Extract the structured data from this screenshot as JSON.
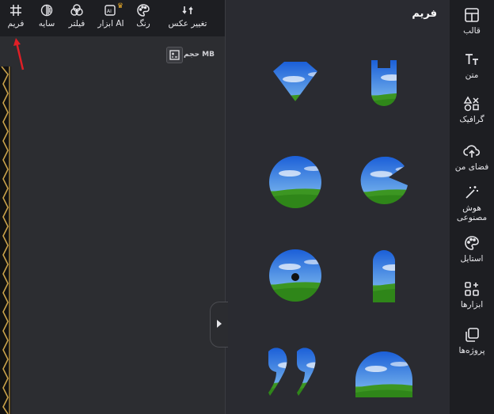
{
  "toolbar": {
    "items": [
      {
        "label": "تغییر عکس",
        "icon": "swap-arrows-icon"
      },
      {
        "label": "رنگ",
        "icon": "palette-icon"
      },
      {
        "label": "ابزار AI",
        "icon": "ai-image-icon",
        "badge": "crown"
      },
      {
        "label": "فیلتر",
        "icon": "filter-icon"
      },
      {
        "label": "سایه",
        "icon": "shadow-icon"
      },
      {
        "label": "فریم",
        "icon": "frame-icon"
      }
    ]
  },
  "canvas": {
    "size_label": "حجم MB"
  },
  "panel": {
    "title": "فریم",
    "frames_count": 8
  },
  "sidebar": {
    "items": [
      {
        "label": "قالب",
        "icon": "template-icon"
      },
      {
        "label": "متن",
        "icon": "text-icon"
      },
      {
        "label": "گرافیک",
        "icon": "shapes-icon"
      },
      {
        "label": "فضای من",
        "icon": "cloud-upload-icon"
      },
      {
        "label": "هوش مصنوعی",
        "icon": "magic-wand-icon"
      },
      {
        "label": "استایل",
        "icon": "palette-icon"
      },
      {
        "label": "ابزارها",
        "icon": "tools-grid-icon"
      },
      {
        "label": "پروژه‌ها",
        "icon": "projects-icon"
      }
    ]
  },
  "colors": {
    "accent_gold": "#c9a24a",
    "arrow_red": "#e01f26",
    "panel_bg": "#2a2b31"
  }
}
